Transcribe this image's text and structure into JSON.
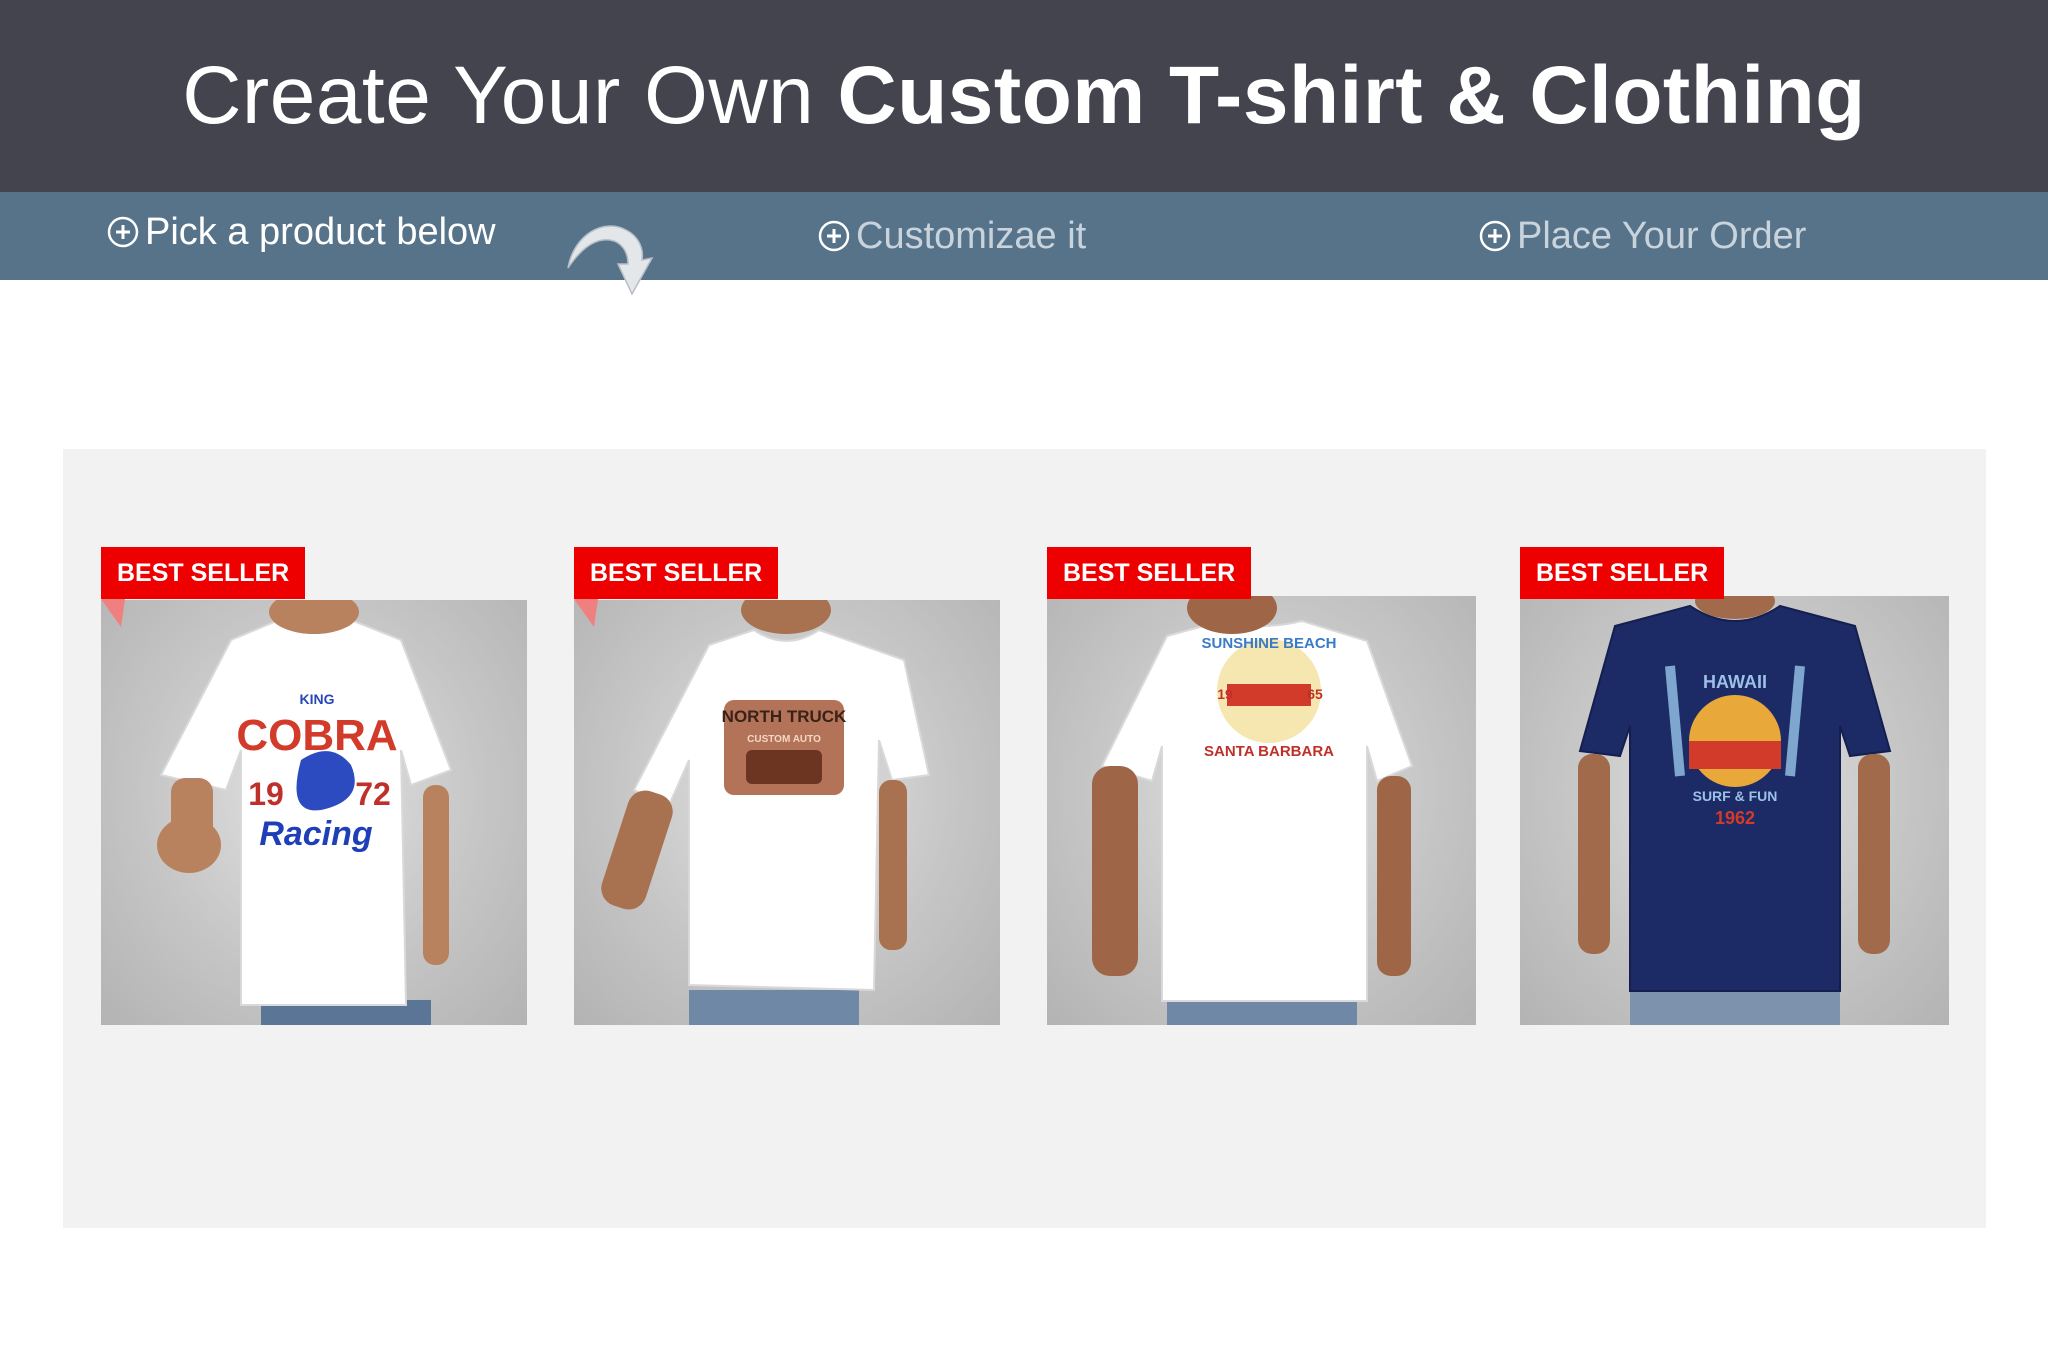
{
  "header": {
    "title_regular": "Create Your Own ",
    "title_bold": "Custom T-shirt & Clothing",
    "background_color": "#44444f"
  },
  "steps": {
    "background_color": "#56738a",
    "items": [
      {
        "label": "Pick a product below",
        "icon": "plus-circle-icon",
        "state": "active"
      },
      {
        "label": "Customizae it",
        "icon": "plus-circle-icon",
        "state": "inactive"
      },
      {
        "label": "Place Your Order",
        "icon": "plus-circle-icon",
        "state": "inactive"
      }
    ],
    "pointer_icon": "curved-arrow-down-icon"
  },
  "products": [
    {
      "badge": "BEST SELLER",
      "shirt_color": "#ffffff",
      "print": [
        "KING",
        "COBRA",
        "19",
        "72",
        "Racing"
      ]
    },
    {
      "badge": "BEST SELLER",
      "shirt_color": "#ffffff",
      "print": [
        "NORTH TRUCK",
        "CUSTOM AUTO"
      ]
    },
    {
      "badge": "BEST SELLER",
      "shirt_color": "#ffffff",
      "print": [
        "SUNSHINE BEACH",
        "19",
        "65",
        "SANTA BARBARA"
      ]
    },
    {
      "badge": "BEST SELLER",
      "shirt_color": "#1c2a66",
      "print": [
        "HAWAII",
        "SURF & FUN",
        "1962"
      ]
    }
  ],
  "colors": {
    "badge": "#ee0000",
    "panel": "#f2f2f2"
  }
}
